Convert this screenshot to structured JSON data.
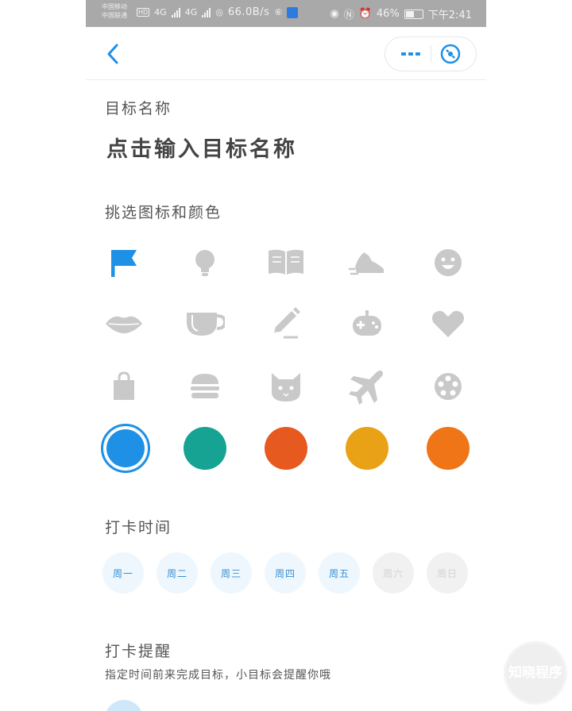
{
  "status_bar": {
    "carrier1": "中国移动",
    "carrier2": "中国联通",
    "net1": "4G",
    "net2": "4G",
    "hd": "HD",
    "speed": "66.0B/s",
    "battery": "46%",
    "time": "下午2:41"
  },
  "header": {
    "back_icon": "chevron-left-icon",
    "more_icon": "more-dots-icon",
    "close_icon": "close-circle-icon"
  },
  "form": {
    "name_label": "目标名称",
    "name_placeholder": "点击输入目标名称",
    "icon_color_label": "挑选图标和颜色",
    "checkin_time_label": "打卡时间",
    "reminder_label": "打卡提醒",
    "reminder_desc": "指定时间前来完成目标，小目标会提醒你哦"
  },
  "icons": [
    {
      "name": "flag-icon",
      "selected": true
    },
    {
      "name": "lightbulb-icon",
      "selected": false
    },
    {
      "name": "book-icon",
      "selected": false
    },
    {
      "name": "running-shoe-icon",
      "selected": false
    },
    {
      "name": "smile-icon",
      "selected": false
    },
    {
      "name": "lips-icon",
      "selected": false
    },
    {
      "name": "cup-icon",
      "selected": false
    },
    {
      "name": "pencil-icon",
      "selected": false
    },
    {
      "name": "gamepad-icon",
      "selected": false
    },
    {
      "name": "heart-icon",
      "selected": false
    },
    {
      "name": "shopping-bag-icon",
      "selected": false
    },
    {
      "name": "burger-icon",
      "selected": false
    },
    {
      "name": "cat-icon",
      "selected": false
    },
    {
      "name": "airplane-icon",
      "selected": false
    },
    {
      "name": "film-reel-icon",
      "selected": false
    }
  ],
  "colors": [
    {
      "hex": "#1e90e6",
      "selected": true
    },
    {
      "hex": "#16a394",
      "selected": false
    },
    {
      "hex": "#e65a20",
      "selected": false
    },
    {
      "hex": "#e9a215",
      "selected": false
    },
    {
      "hex": "#ef7516",
      "selected": false
    }
  ],
  "days": [
    {
      "label": "周一",
      "active": true
    },
    {
      "label": "周二",
      "active": true
    },
    {
      "label": "周三",
      "active": true
    },
    {
      "label": "周四",
      "active": true
    },
    {
      "label": "周五",
      "active": true
    },
    {
      "label": "周六",
      "active": false
    },
    {
      "label": "周日",
      "active": false
    }
  ],
  "watermark": "知晓程序",
  "theme": {
    "accent": "#1e90e6",
    "icon_inactive": "#c9c9c9"
  }
}
